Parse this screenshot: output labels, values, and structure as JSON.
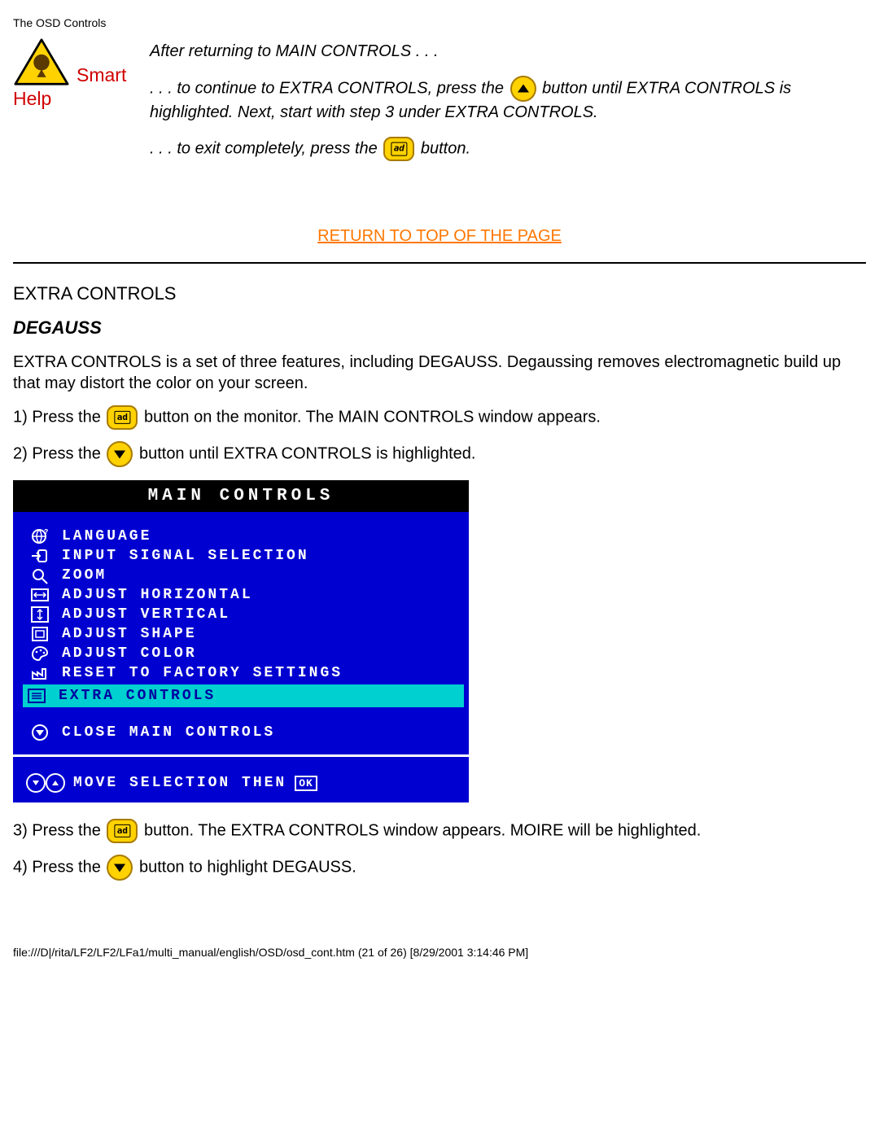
{
  "header": "The OSD Controls",
  "smart_label": "Smart",
  "help_label": "Help",
  "intro": {
    "line1": "After returning to MAIN CONTROLS . . .",
    "line2a": ". . . to continue to EXTRA CONTROLS, press the ",
    "line2b": " button until EXTRA CONTROLS is highlighted. Next, start with step 3 under EXTRA CONTROLS.",
    "line3a": ". . . to exit completely, press the ",
    "line3b": " button."
  },
  "top_link": "RETURN TO TOP OF THE PAGE",
  "section_title": "EXTRA CONTROLS",
  "sub_title": "DEGAUSS",
  "desc": "EXTRA CONTROLS is a set of three features, including DEGAUSS. Degaussing removes electromagnetic build up that may distort the color on your screen.",
  "step1a": "1) Press the ",
  "step1b": " button on the monitor. The MAIN CONTROLS window appears.",
  "step2a": "2) Press the ",
  "step2b": " button until EXTRA CONTROLS is highlighted.",
  "step3a": "3) Press the ",
  "step3b": " button. The EXTRA CONTROLS window appears. MOIRE will be highlighted.",
  "step4a": "4) Press the ",
  "step4b": " button to highlight DEGAUSS.",
  "osd": {
    "title": "MAIN CONTROLS",
    "items": [
      {
        "label": "LANGUAGE"
      },
      {
        "label": "INPUT SIGNAL SELECTION"
      },
      {
        "label": "ZOOM"
      },
      {
        "label": "ADJUST HORIZONTAL"
      },
      {
        "label": "ADJUST VERTICAL"
      },
      {
        "label": "ADJUST SHAPE"
      },
      {
        "label": "ADJUST COLOR"
      },
      {
        "label": "RESET TO FACTORY SETTINGS"
      },
      {
        "label": "EXTRA CONTROLS"
      }
    ],
    "close": "CLOSE MAIN CONTROLS",
    "footer": "MOVE SELECTION THEN",
    "ok": "OK"
  },
  "footer_path": "file:///D|/rita/LF2/LF2/LFa1/multi_manual/english/OSD/osd_cont.htm (21 of 26) [8/29/2001 3:14:46 PM]"
}
